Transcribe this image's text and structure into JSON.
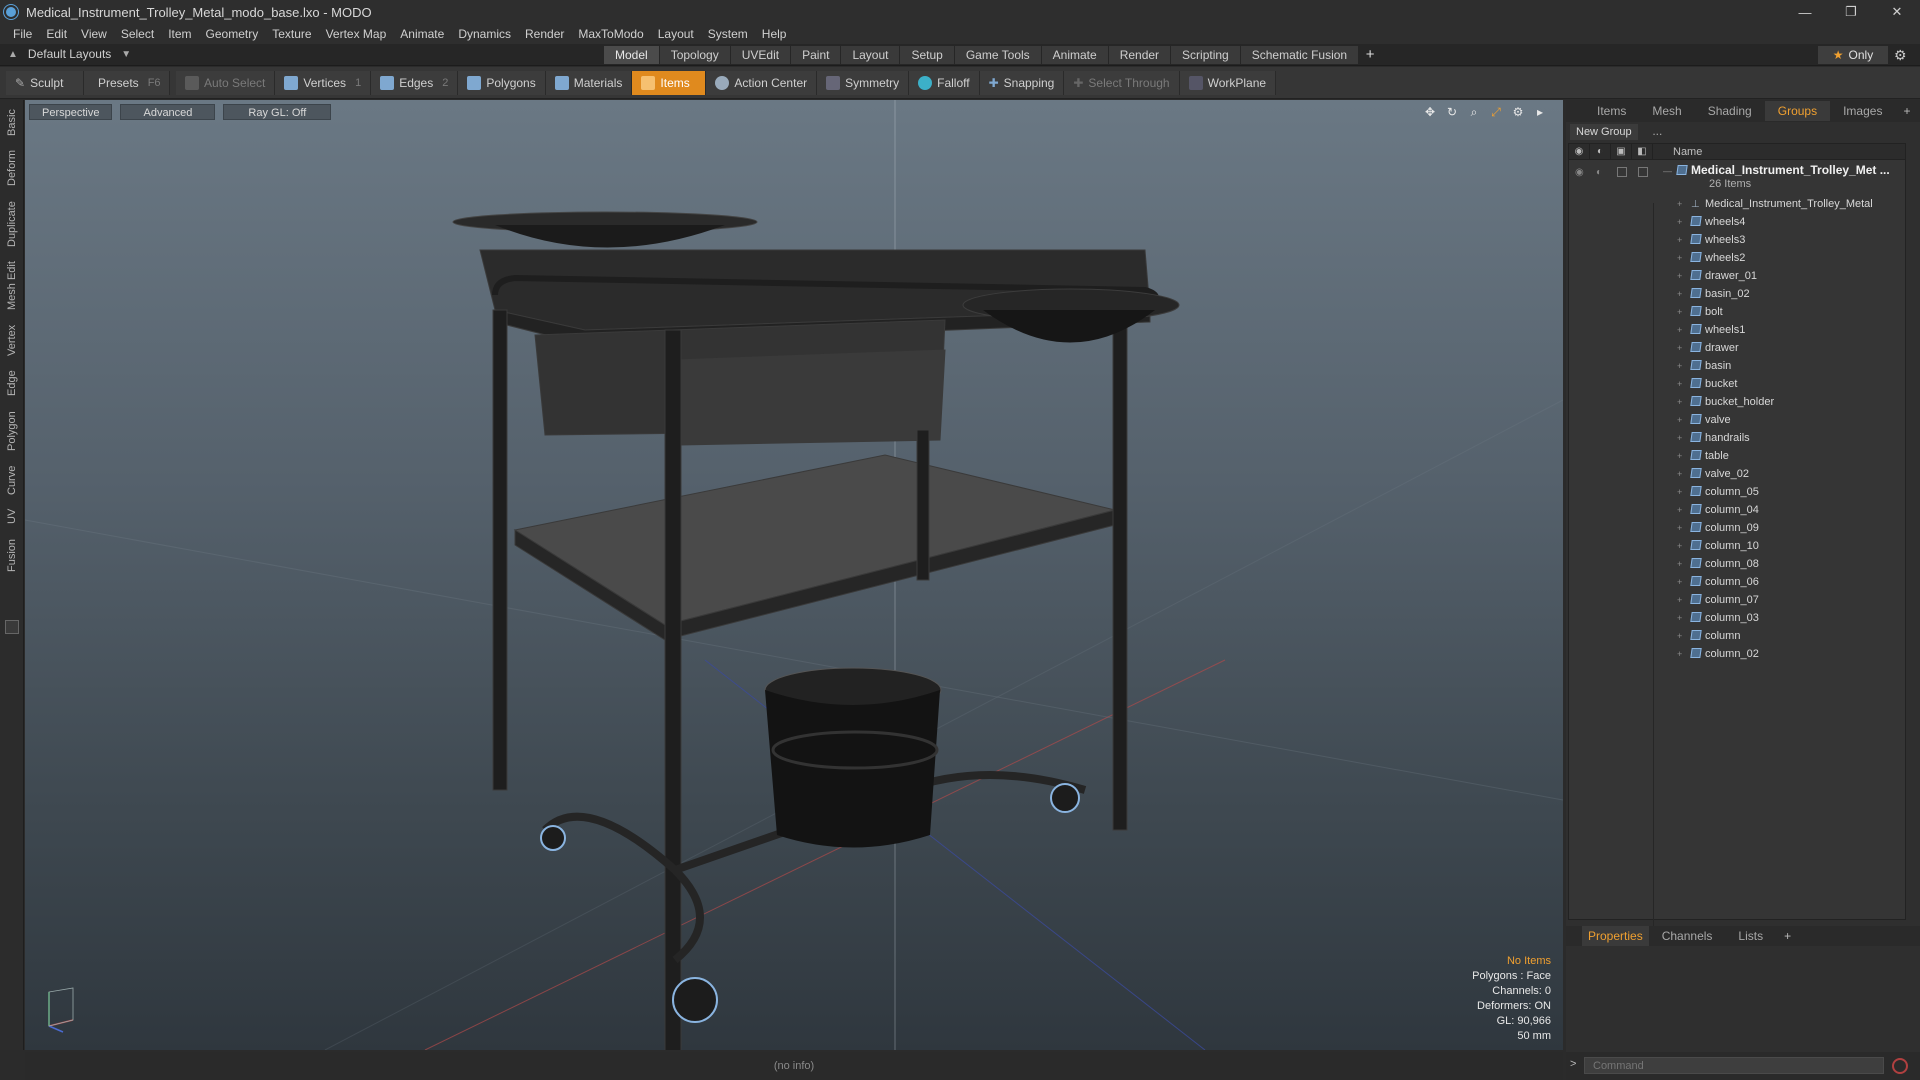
{
  "window": {
    "title": "Medical_Instrument_Trolley_Metal_modo_base.lxo - MODO",
    "minimize": "—",
    "restore": "❐",
    "close": "✕"
  },
  "menu": [
    "File",
    "Edit",
    "View",
    "Select",
    "Item",
    "Geometry",
    "Texture",
    "Vertex Map",
    "Animate",
    "Dynamics",
    "Render",
    "MaxToModo",
    "Layout",
    "System",
    "Help"
  ],
  "layout": {
    "name": "Default Layouts"
  },
  "mode_tabs": [
    "Model",
    "Topology",
    "UVEdit",
    "Paint",
    "Layout",
    "Setup",
    "Game Tools",
    "Animate",
    "Render",
    "Scripting",
    "Schematic Fusion"
  ],
  "only_label": "Only",
  "toolbar": {
    "sculpt": "Sculpt",
    "presets": "Presets",
    "presets_key": "F6",
    "auto_select": "Auto Select",
    "vertices": "Vertices",
    "vertices_count": "1",
    "edges": "Edges",
    "edges_count": "2",
    "polygons": "Polygons",
    "materials": "Materials",
    "items": "Items",
    "action_center": "Action Center",
    "symmetry": "Symmetry",
    "falloff": "Falloff",
    "snapping": "Snapping",
    "select_through": "Select Through",
    "workplane": "WorkPlane"
  },
  "side_tabs": [
    "Basic",
    "Deform",
    "Duplicate",
    "Mesh Edit",
    "Vertex",
    "Edge",
    "Polygon",
    "Curve",
    "UV",
    "Fusion"
  ],
  "viewport": {
    "view": "Perspective",
    "shading": "Advanced",
    "raygl": "Ray GL: Off",
    "info": {
      "selection": "No Items",
      "polygons": "Polygons : Face",
      "channels": "Channels: 0",
      "deformers": "Deformers: ON",
      "gl": "GL: 90,966",
      "scale": "50 mm"
    }
  },
  "panel": {
    "tabs": [
      "Items",
      "Mesh ...",
      "Shading",
      "Groups",
      "Images"
    ],
    "active_tab": "Groups",
    "new_group": "New Group",
    "name_col": "Name",
    "group": {
      "name": "Medical_Instrument_Trolley_Met ...",
      "count": "26 Items"
    },
    "items": [
      "Medical_Instrument_Trolley_Metal",
      "wheels4",
      "wheels3",
      "wheels2",
      "drawer_01",
      "basin_02",
      "bolt",
      "wheels1",
      "drawer",
      "basin",
      "bucket",
      "bucket_holder",
      "valve",
      "handrails",
      "table",
      "valve_02",
      "column_05",
      "column_04",
      "column_09",
      "column_10",
      "column_08",
      "column_06",
      "column_07",
      "column_03",
      "column",
      "column_02"
    ],
    "bottom_tabs": [
      "Properties",
      "Channels",
      "Lists"
    ]
  },
  "status": {
    "info": "(no info)"
  },
  "command": {
    "placeholder": "Command"
  },
  "colors": {
    "accent": "#e08a1e",
    "selected_tab": "#f0a030"
  }
}
